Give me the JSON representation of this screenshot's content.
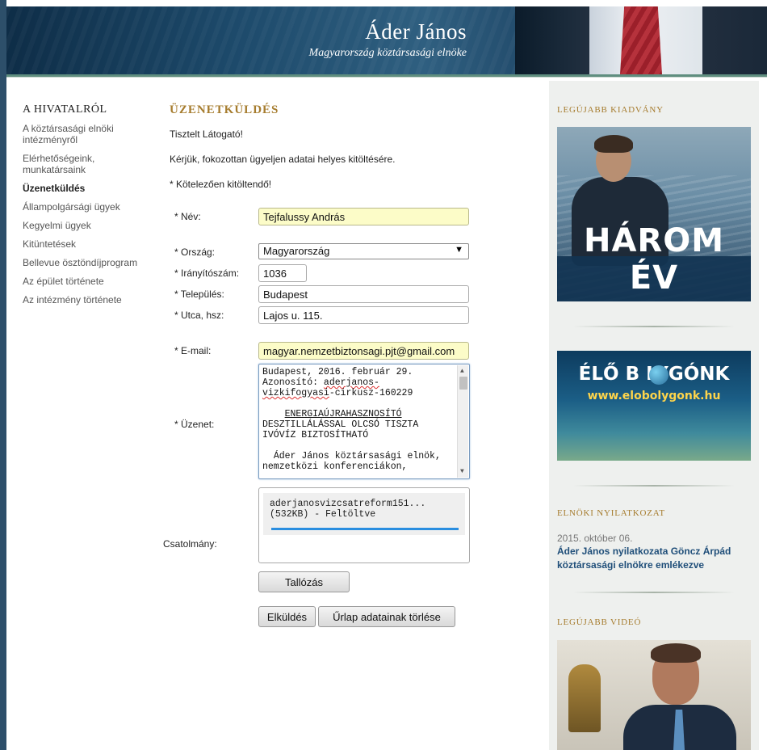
{
  "header": {
    "title": "Áder János",
    "subtitle": "Magyarország köztársasági elnöke"
  },
  "nav": {
    "title": "A HIVATALRÓL",
    "items": [
      {
        "label": "A köztársasági elnöki intézményről"
      },
      {
        "label": "Elérhetőségeink, munkatársaink"
      },
      {
        "label": "Üzenetküldés"
      },
      {
        "label": "Állampolgársági ügyek"
      },
      {
        "label": "Kegyelmi ügyek"
      },
      {
        "label": "Kitüntetések"
      },
      {
        "label": "Bellevue ösztöndíjprogram"
      },
      {
        "label": "Az épület története"
      },
      {
        "label": "Az intézmény története"
      }
    ]
  },
  "main": {
    "title": "ÜZENETKÜLDÉS",
    "greeting": "Tisztelt Látogató!",
    "instruction": "Kérjük, fokozottan ügyeljen adatai helyes kitöltésére.",
    "required_note": "* Kötelezően kitöltendő!"
  },
  "form": {
    "name_label": "* Név:",
    "name_value": "Tejfalussy András",
    "country_label": "* Ország:",
    "country_value": "Magyarország",
    "zip_label": "* Irányítószám:",
    "zip_value": "1036",
    "city_label": "* Település:",
    "city_value": "Budapest",
    "street_label": "* Utca, hsz:",
    "street_value": "Lajos u. 115.",
    "email_label": "* E-mail:",
    "email_value": "magyar.nemzetbiztonsagi.pjt@gmail.com",
    "message_label": "* Üzenet:",
    "message_lines": {
      "l1": "Budapest, 2016. február 29.",
      "l2a": "Azonosító: ",
      "l2b": "aderjanos-",
      "l3": "vizkifogyasi",
      "l3b": "-cirkusz-160229",
      "l4": "ENERGIAÚJRAHASZNOSÍTÓ",
      "l5": "DESZTILLÁLÁSSAL OLCSÓ TISZTA",
      "l6": "IVÓVÍZ BIZTOSÍTHATÓ",
      "l7": "Áder János köztársasági elnök,",
      "l8": "nemzetközi konferenciákon,"
    },
    "attachment_label": "Csatolmány:",
    "attachment_file": "aderjanosvizcsatreform151...",
    "attachment_status": "(532KB) - Feltöltve",
    "attachment_progress": 1.0,
    "browse_button": "Tallózás",
    "send_button": "Elküldés",
    "clear_button": "Űrlap adatainak törlése"
  },
  "sidebar": {
    "latest_publication_title": "LEGÚJABB KIADVÁNY",
    "promo1_text": "HÁROM ÉV",
    "promo2_line1": "ÉLŐ B  LYGÓNK",
    "promo2_line2": "www.elobolygonk.hu",
    "statement_title": "ELNÖKI NYILATKOZAT",
    "statement_date": "2015. október 06.",
    "statement_link": "Áder János nyilatkozata Göncz Árpád köztársasági elnökre emlékezve",
    "video_title": "LEGÚJABB VIDEÓ"
  }
}
